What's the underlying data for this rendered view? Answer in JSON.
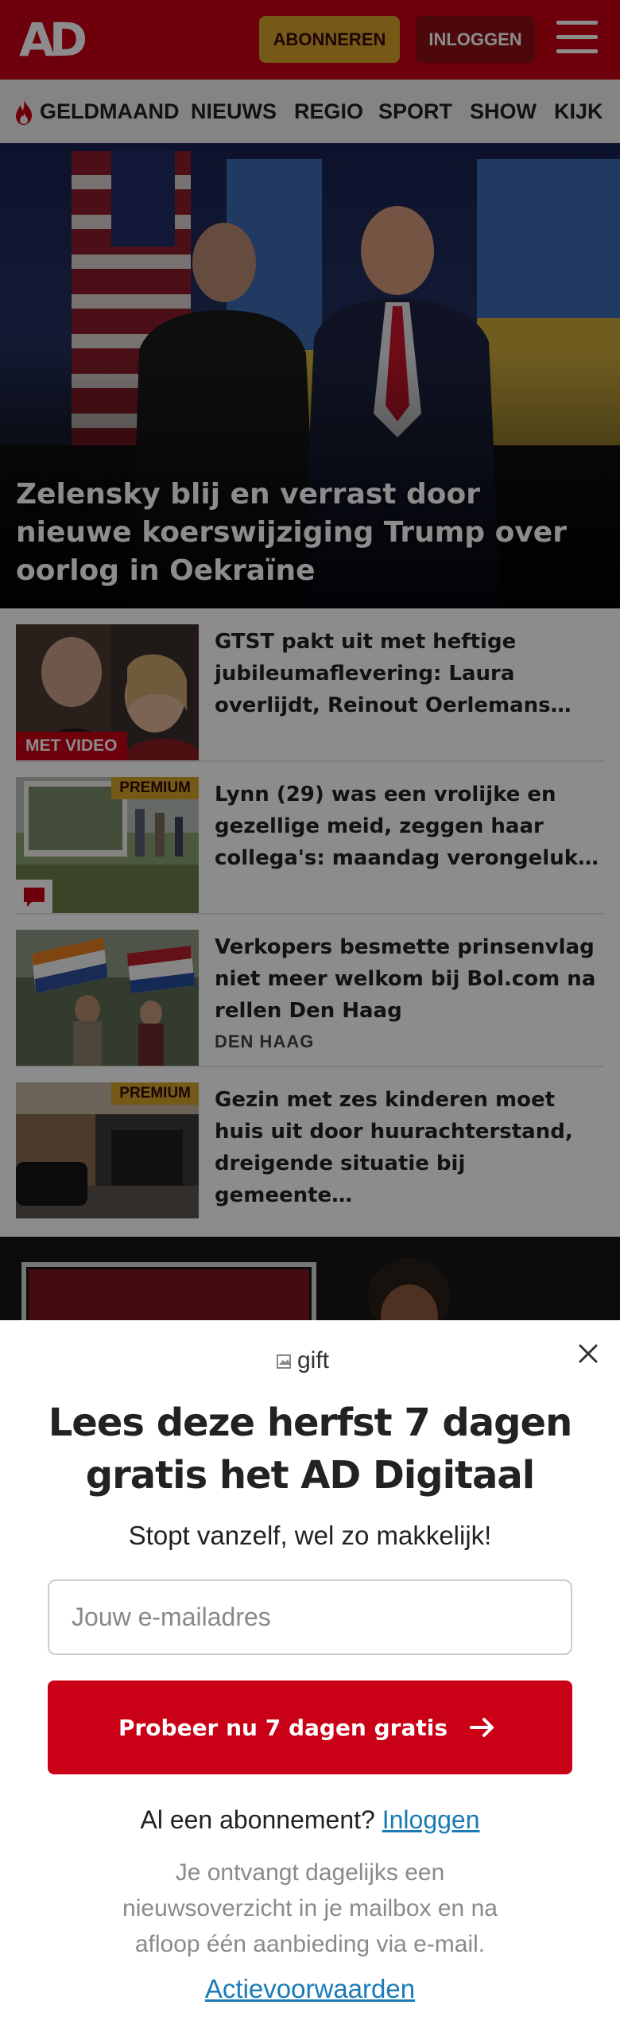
{
  "header": {
    "logo": "AD",
    "subscribe_label": "ABONNEREN",
    "login_label": "INLOGGEN",
    "menu_icon": "hamburger-menu-icon"
  },
  "nav": {
    "items": [
      "GELDMAAND",
      "NIEUWS",
      "REGIO",
      "SPORT",
      "SHOW",
      "KIJK"
    ],
    "highlight_icon": "flame-icon",
    "highlight_color": "#c90016"
  },
  "hero": {
    "title": "Zelensky blij en verrast door nieuwe koerswijziging Trump over oorlog in Oekraïne"
  },
  "articles": [
    {
      "title": "GTST pakt uit met heftige jubileumaflevering: Laura overlijdt, Reinout Oerlemans…",
      "badge": "MET VIDEO"
    },
    {
      "title": "Lynn (29) was een vrolijke en gezellige meid, zeggen haar collega's: maandag verongeluk…",
      "badge": "PREMIUM",
      "comment_icon": "comment-icon"
    },
    {
      "title": "Verkopers besmette prinsenvlag niet meer welkom bij Bol.com na rellen Den Haag",
      "location": "DEN HAAG"
    },
    {
      "title": "Gezin met zes kinderen moet huis uit door huurachterstand, dreigende situatie bij gemeente…",
      "badge": "PREMIUM"
    }
  ],
  "modal": {
    "gift_alt": "gift",
    "title": "Lees deze herfst 7 dagen gratis het AD Digitaal",
    "subtitle": "Stopt vanzelf, wel zo makkelijk!",
    "email_placeholder": "Jouw e-mailadres",
    "cta_label": "Probeer nu 7 dagen gratis",
    "already_text": "Al een abonnement?",
    "login_link": "Inloggen",
    "info": "Je ontvangt dagelijks een nieuwsoverzicht in je mailbox en na afloop één aanbieding via e-mail.",
    "terms_link": "Actievoorwaarden"
  },
  "colors": {
    "brand_red": "#c90016",
    "premium_gold": "#d3a22b",
    "link_blue": "#1a7bb8"
  }
}
